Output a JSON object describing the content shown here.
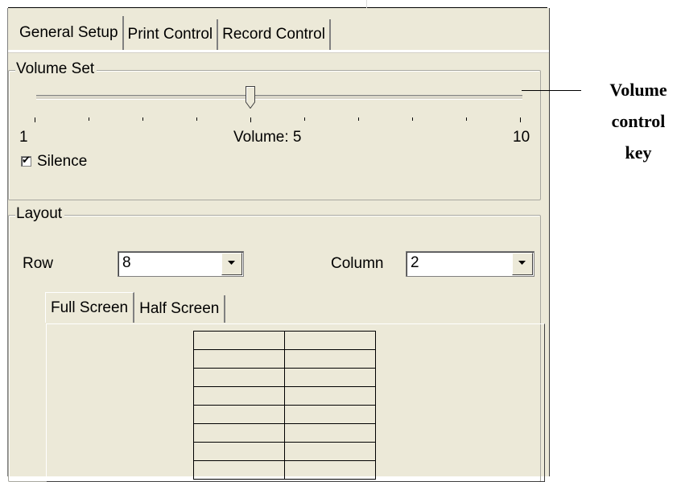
{
  "tabs": [
    {
      "label": "General Setup",
      "active": true
    },
    {
      "label": "Print Control",
      "active": false
    },
    {
      "label": "Record Control",
      "active": false
    }
  ],
  "volume_group": {
    "legend": "Volume Set",
    "slider": {
      "min": 1,
      "max": 10,
      "value": 5
    },
    "min_label": "1",
    "max_label": "10",
    "value_label": "Volume: 5",
    "silence": {
      "label": "Silence",
      "checked": true
    }
  },
  "layout_group": {
    "legend": "Layout",
    "row": {
      "label": "Row",
      "value": "8"
    },
    "column": {
      "label": "Column",
      "value": "2"
    },
    "subtabs": [
      {
        "label": "Full Screen",
        "active": true
      },
      {
        "label": "Half Screen",
        "active": false
      }
    ],
    "preview": {
      "rows": 8,
      "columns": 2
    }
  },
  "annotation": {
    "lines": [
      "Volume",
      "control",
      "key"
    ]
  }
}
